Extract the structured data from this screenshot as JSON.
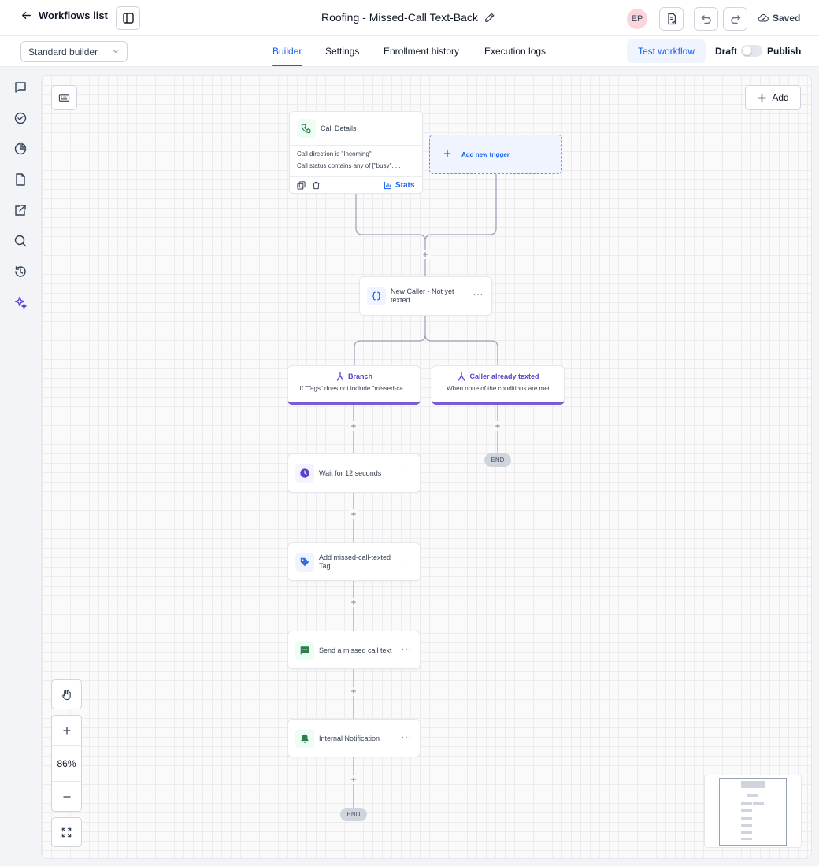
{
  "header": {
    "back_label": "Workflows list",
    "workflow_title": "Roofing - Missed-Call Text-Back",
    "avatar_initials": "EP",
    "saved_label": "Saved"
  },
  "subbar": {
    "builder_select": "Standard builder",
    "tabs": [
      {
        "label": "Builder",
        "active": true
      },
      {
        "label": "Settings",
        "active": false
      },
      {
        "label": "Enrollment history",
        "active": false
      },
      {
        "label": "Execution logs",
        "active": false
      }
    ],
    "test_label": "Test workflow",
    "draft_label": "Draft",
    "publish_label": "Publish"
  },
  "rail": {
    "icons": [
      "chat-icon",
      "check-circle-icon",
      "pie-chart-icon",
      "document-icon",
      "external-link-icon",
      "search-icon",
      "history-icon",
      "sparkle-icon"
    ]
  },
  "canvas": {
    "add_label": "Add",
    "zoom": "86%",
    "trigger": {
      "title": "Call Details",
      "conditions": [
        "Call direction is \"Incoming\"",
        "Call status contains any of [\"busy\", ..."
      ],
      "stats_label": "Stats"
    },
    "add_trigger_label": "Add new trigger",
    "condition_node": {
      "label_line1": "New Caller - Not yet",
      "label_line2": "texted"
    },
    "branches": [
      {
        "title": "Branch",
        "subtitle": "If \"Tags\" does not include \"missed-ca..."
      },
      {
        "title": "Caller already texted",
        "subtitle": "When none of the conditions are met"
      }
    ],
    "actions": [
      {
        "label_line1": "Wait for 12 seconds",
        "label_line2": "",
        "icon": "clock-icon"
      },
      {
        "label_line1": "Add missed-call-texted",
        "label_line2": "Tag",
        "icon": "tag-icon"
      },
      {
        "label_line1": "Send a missed call text",
        "label_line2": "",
        "icon": "sms-icon"
      },
      {
        "label_line1": "Internal Notification",
        "label_line2": "",
        "icon": "bell-icon"
      }
    ],
    "end_label": "END",
    "colors": {
      "accent": "#155eef",
      "branch": "#7c5cd6",
      "clock": "#5b3fcc",
      "tag": "#2f6fe4",
      "sms": "#2e7d4f",
      "bell": "#2e7d4f"
    }
  }
}
